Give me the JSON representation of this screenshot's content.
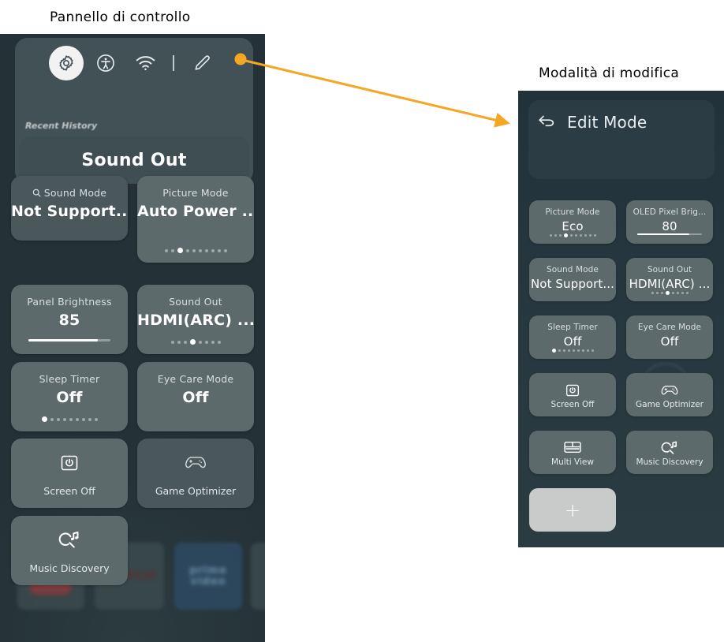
{
  "captions": {
    "left": "Pannello di controllo",
    "right": "Modalità di modifica"
  },
  "colors": {
    "callout_orange": "#f5a623",
    "panel_bg_left": "#243136",
    "panel_bg_right": "#22323a",
    "tile_bg": "#5d6a6c",
    "tile_bg_dim": "#4a585b",
    "text_primary": "#ffffff",
    "text_secondary": "#d9dfe0",
    "add_tile_bg": "#c8cbc9"
  },
  "control_panel": {
    "icon_bar": [
      {
        "name": "settings-icon",
        "label": "Settings",
        "active": true
      },
      {
        "name": "accessibility-icon",
        "label": "Accessibility",
        "active": false
      },
      {
        "name": "wifi-icon",
        "label": "Wi-Fi",
        "active": false
      },
      {
        "name": "divider",
        "label": "",
        "active": false
      },
      {
        "name": "edit-pencil-icon",
        "label": "Edit",
        "active": false
      }
    ],
    "recent_history_label": "Recent History",
    "recent_item_label": "Sound Out",
    "tiles": [
      {
        "title": "Sound Mode",
        "value": "Not Support...",
        "icon": "search-icon",
        "dim": true,
        "dots": null,
        "slider": null
      },
      {
        "title": "Picture Mode",
        "value": "Auto Power ...",
        "icon": null,
        "dim": false,
        "dots": {
          "count": 10,
          "active": 2
        },
        "slider": null
      },
      {
        "title": "Panel Brightness",
        "value": "85",
        "icon": null,
        "dim": false,
        "dots": null,
        "slider": 85
      },
      {
        "title": "Sound Out",
        "value": "HDMI(ARC) ...",
        "icon": null,
        "dim": false,
        "dots": {
          "count": 8,
          "active": 3
        },
        "slider": null
      },
      {
        "title": "Sleep Timer",
        "value": "Off",
        "icon": null,
        "dim": false,
        "dots": {
          "count": 9,
          "active": 0
        },
        "slider": null
      },
      {
        "title": "Eye Care Mode",
        "value": "Off",
        "icon": null,
        "dim": false,
        "dots": null,
        "slider": null
      }
    ],
    "action_tiles": [
      {
        "label": "Screen Off",
        "icon": "power-screen-off-icon",
        "dim": false
      },
      {
        "label": "Game Optimizer",
        "icon": "gamepad-icon",
        "dim": true
      },
      {
        "label": "Music Discovery",
        "icon": "music-search-icon",
        "dim": false
      }
    ],
    "background_apps": [
      {
        "name": "youtube-app-tile",
        "label": ""
      },
      {
        "name": "netflix-app-tile",
        "label": "NETFLIX"
      },
      {
        "name": "prime-video-app-tile",
        "label_top": "prime",
        "label_bottom": "video"
      }
    ]
  },
  "edit_mode": {
    "back_label": "Edit Mode",
    "tiles": [
      {
        "title": "Picture Mode",
        "value": "Eco",
        "dots": {
          "count": 10,
          "active": 3
        },
        "slider": null
      },
      {
        "title": "OLED Pixel Brig...",
        "value": "80",
        "dots": null,
        "slider": 80
      },
      {
        "title": "Sound Mode",
        "value": "Not Support...",
        "dots": null,
        "slider": null
      },
      {
        "title": "Sound Out",
        "value": "HDMI(ARC) ...",
        "dots": {
          "count": 8,
          "active": 3
        },
        "slider": null
      },
      {
        "title": "Sleep Timer",
        "value": "Off",
        "dots": {
          "count": 9,
          "active": 0
        },
        "slider": null
      },
      {
        "title": "Eye Care Mode",
        "value": "Off",
        "dots": null,
        "slider": null
      }
    ],
    "action_tiles": [
      {
        "label": "Screen Off",
        "icon": "power-screen-off-icon"
      },
      {
        "label": "Game Optimizer",
        "icon": "gamepad-icon"
      },
      {
        "label": "Multi View",
        "icon": "multi-view-icon"
      },
      {
        "label": "Music Discovery",
        "icon": "music-search-icon"
      }
    ],
    "add_button_label": "+"
  }
}
